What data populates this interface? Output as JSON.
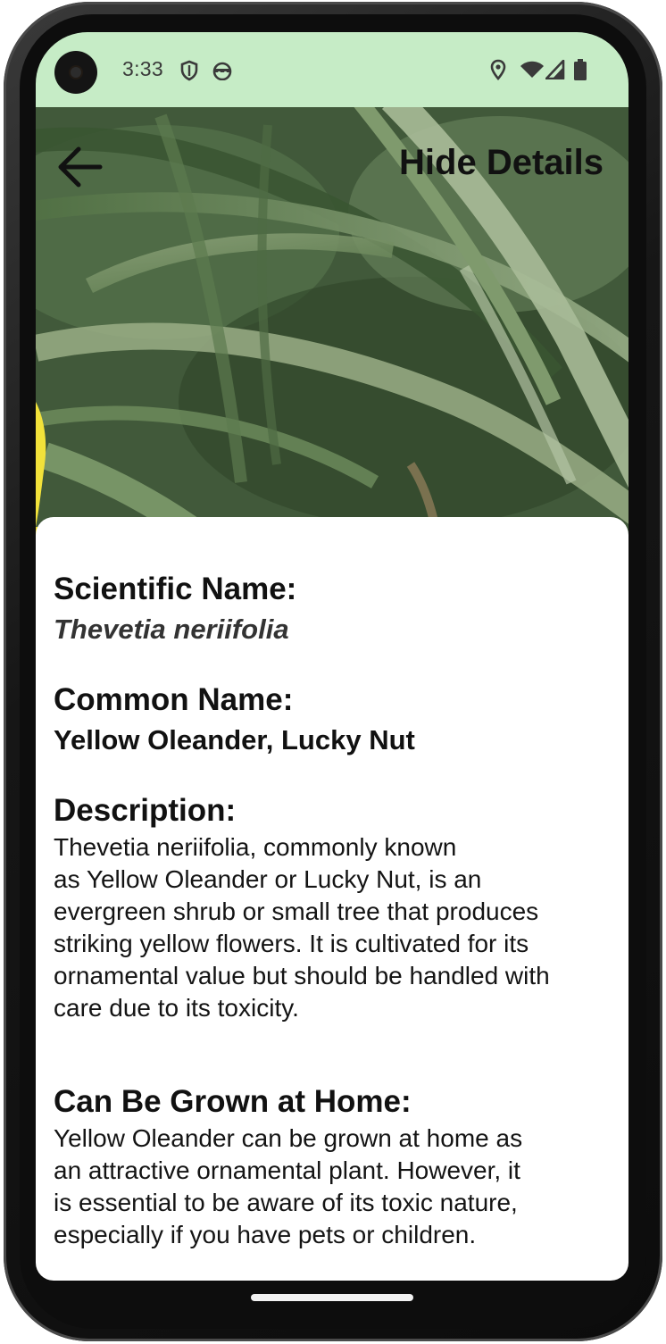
{
  "status_bar": {
    "time": "3:33",
    "left_icons": [
      "shield-icon",
      "android-face-icon"
    ],
    "right_icons": [
      "location-pin-icon",
      "wifi-icon",
      "cell-signal-icon",
      "battery-icon"
    ],
    "background": "#c6ecc6"
  },
  "header": {
    "back_icon": "arrow-left-icon",
    "toggle_label": "Hide Details"
  },
  "details": {
    "scientific_name_label": "Scientific Name:",
    "scientific_name_value": "Thevetia neriifolia",
    "common_name_label": "Common Name:",
    "common_name_value": "Yellow Oleander, Lucky Nut",
    "description_label": "Description:",
    "description_lines": [
      "Thevetia neriifolia, commonly known",
      "as Yellow Oleander or Lucky Nut, is an",
      "evergreen shrub or small tree that produces",
      "striking yellow flowers. It is cultivated for its",
      "ornamental value but should be handled with",
      "care due to its toxicity."
    ],
    "grown_at_home_label": "Can Be Grown at Home:",
    "grown_at_home_lines": [
      "Yellow Oleander can be grown at home as",
      "an attractive ornamental plant. However, it",
      "is essential to be aware of its toxic nature,",
      "especially if you have pets or children."
    ]
  }
}
